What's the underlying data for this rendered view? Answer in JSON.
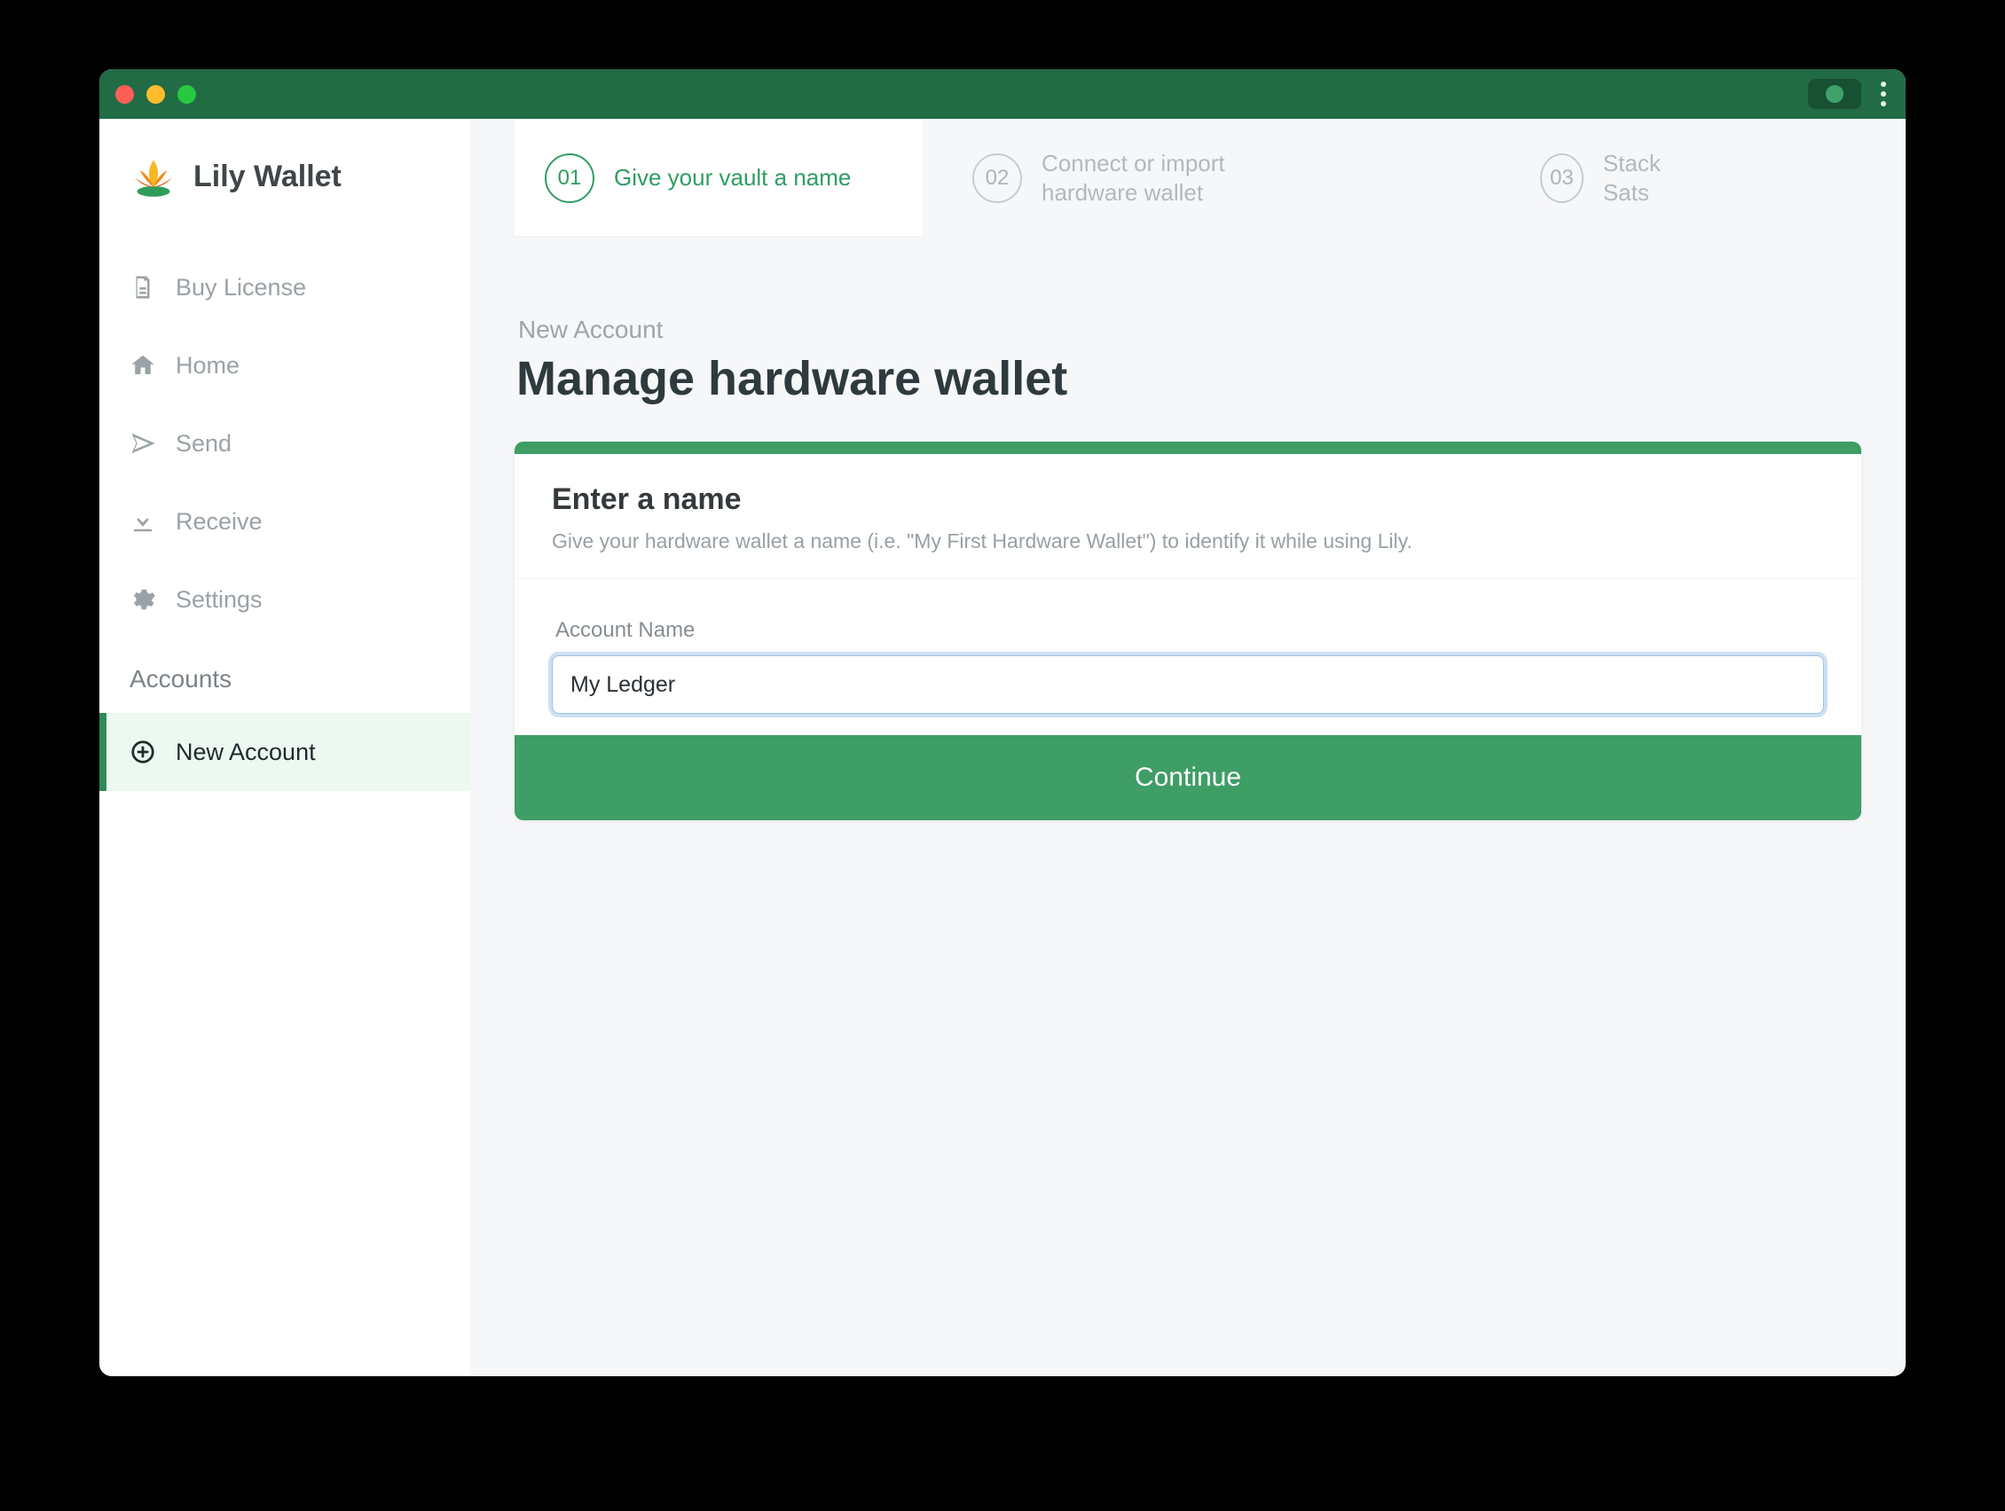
{
  "app": {
    "name": "Lily Wallet"
  },
  "sidebar": {
    "items": [
      {
        "label": "Buy License"
      },
      {
        "label": "Home"
      },
      {
        "label": "Send"
      },
      {
        "label": "Receive"
      },
      {
        "label": "Settings"
      }
    ],
    "section_label": "Accounts",
    "accounts": [
      {
        "label": "New Account"
      }
    ]
  },
  "stepper": {
    "steps": [
      {
        "num": "01",
        "label": "Give your vault a name"
      },
      {
        "num": "02",
        "label": "Connect or import hardware wallet"
      },
      {
        "num": "03",
        "label": "Stack Sats"
      }
    ]
  },
  "page": {
    "eyebrow": "New Account",
    "title": "Manage hardware wallet"
  },
  "card": {
    "heading": "Enter a name",
    "sub": "Give your hardware wallet a name (i.e. \"My First Hardware Wallet\") to identify it while using Lily.",
    "field_label": "Account Name",
    "field_value": "My Ledger",
    "button": "Continue"
  },
  "colors": {
    "accent": "#3f9d66",
    "titlebar": "#216b45"
  }
}
